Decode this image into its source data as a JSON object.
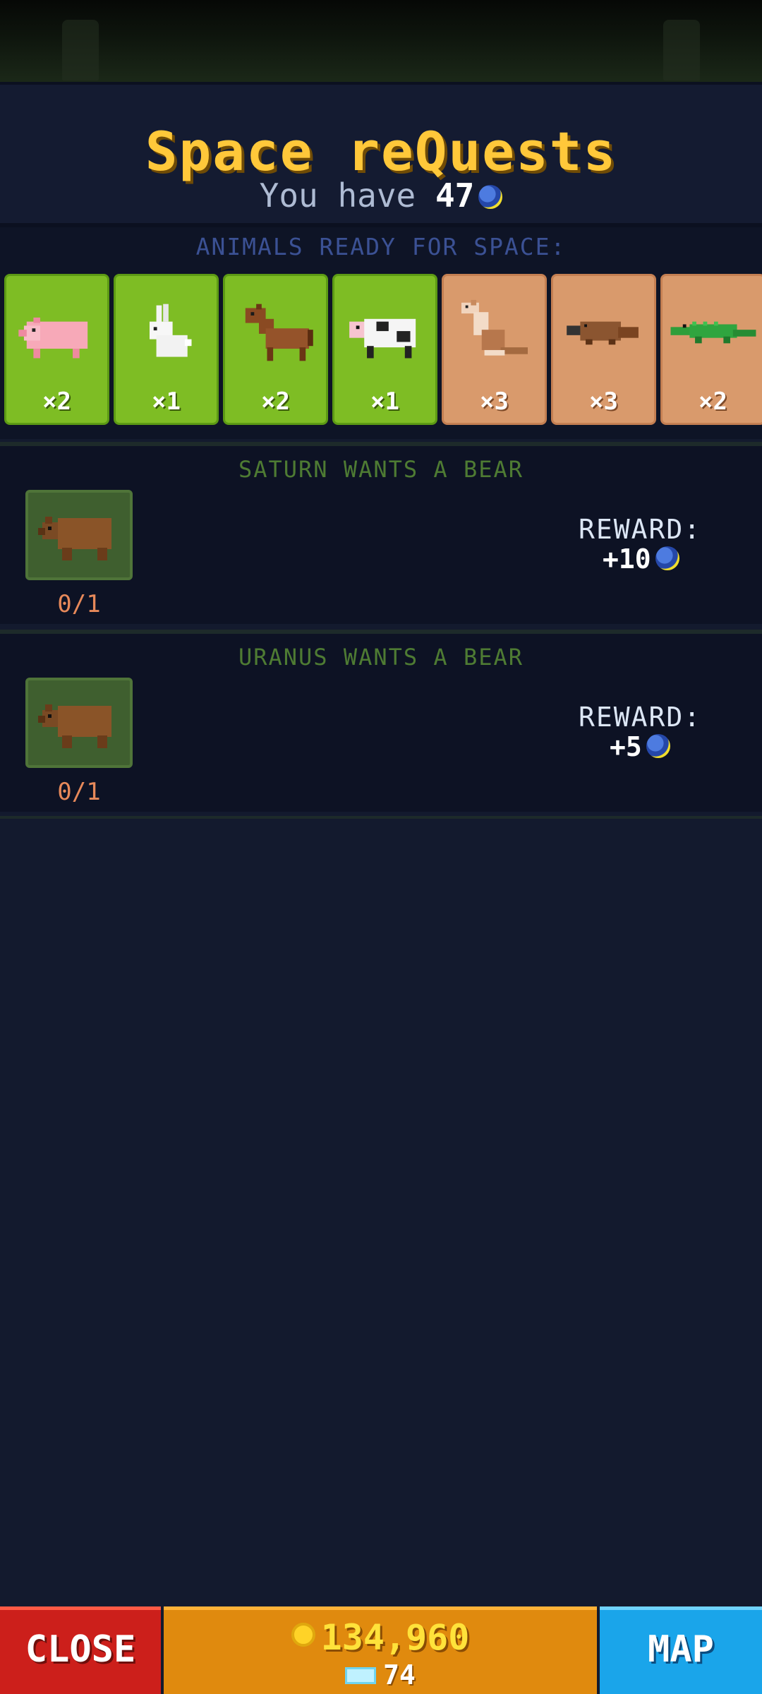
{
  "header": {
    "title": "Space reQuests",
    "you_have_label": "You have",
    "you_have_count": "47"
  },
  "ready": {
    "label": "ANIMALS READY FOR SPACE:",
    "animals": [
      {
        "name": "pig",
        "count": "×2",
        "bg": "green"
      },
      {
        "name": "rabbit",
        "count": "×1",
        "bg": "green"
      },
      {
        "name": "horse",
        "count": "×2",
        "bg": "green"
      },
      {
        "name": "cow",
        "count": "×1",
        "bg": "green"
      },
      {
        "name": "kangaroo",
        "count": "×3",
        "bg": "sand"
      },
      {
        "name": "platypus",
        "count": "×3",
        "bg": "sand"
      },
      {
        "name": "crocodile",
        "count": "×2",
        "bg": "sand"
      }
    ]
  },
  "quests": [
    {
      "title": "SATURN WANTS A BEAR",
      "progress": "0/1",
      "reward_label": "REWARD:",
      "reward": "+10",
      "icon": "bear"
    },
    {
      "title": "URANUS WANTS A BEAR",
      "progress": "0/1",
      "reward_label": "REWARD:",
      "reward": "+5",
      "icon": "bear"
    }
  ],
  "bottom": {
    "close_label": "CLOSE",
    "gold": "134,960",
    "gems": "74",
    "map_label": "MAP"
  },
  "colors": {
    "title": "#ffc83a",
    "close_button": "#cc1f1b",
    "money_bar": "#e08a0e",
    "map_button": "#1aa5ea"
  }
}
